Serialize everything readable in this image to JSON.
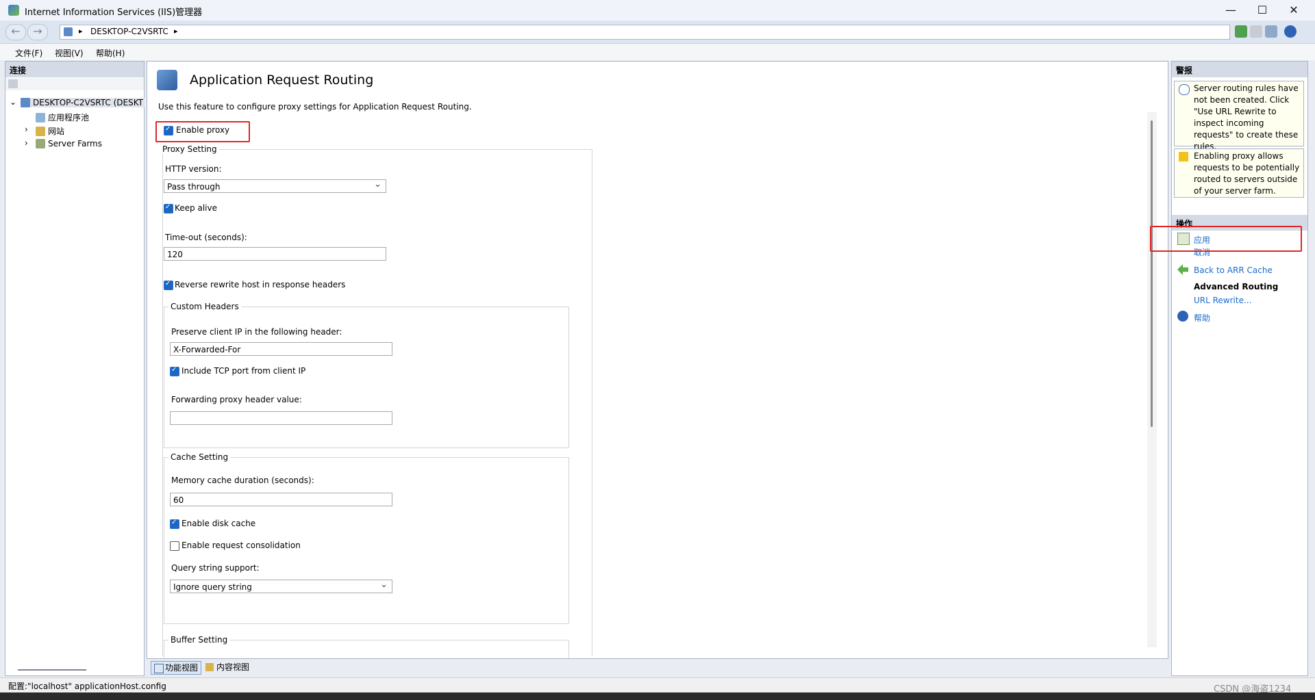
{
  "window": {
    "title": "Internet Information Services (IIS)管理器",
    "min_glyph": "—",
    "max_glyph": "☐",
    "close_glyph": "✕"
  },
  "address": {
    "back_glyph": "←",
    "forward_glyph": "→",
    "crumb": "DESKTOP-C2VSRTC",
    "crumb_arrow": "▸"
  },
  "menu": {
    "file": "文件(F)",
    "view": "视图(V)",
    "help": "帮助(H)"
  },
  "connections": {
    "header": "连接",
    "tree": [
      {
        "label": "DESKTOP-C2VSRTC (DESKT",
        "expander": "⌄"
      },
      {
        "label": "应用程序池",
        "expander": ""
      },
      {
        "label": "网站",
        "expander": "›"
      },
      {
        "label": "Server Farms",
        "expander": "›"
      }
    ]
  },
  "feature": {
    "title": "Application Request Routing",
    "description": "Use this feature to configure proxy settings for Application Request Routing.",
    "enable_proxy": {
      "label": "Enable proxy",
      "checked": true
    },
    "proxy_setting": {
      "title": "Proxy Setting",
      "http_version_label": "HTTP version:",
      "http_version_value": "Pass through",
      "keep_alive": {
        "label": "Keep alive",
        "checked": true
      },
      "timeout_label": "Time-out (seconds):",
      "timeout_value": "120",
      "reverse_rewrite": {
        "label": "Reverse rewrite host in response headers",
        "checked": true
      }
    },
    "custom_headers": {
      "title": "Custom Headers",
      "preserve_ip_label": "Preserve client IP in the following header:",
      "preserve_ip_value": "X-Forwarded-For",
      "include_tcp_port": {
        "label": "Include TCP port from client IP",
        "checked": true
      },
      "forwarding_label": "Forwarding proxy header value:",
      "forwarding_value": ""
    },
    "cache_setting": {
      "title": "Cache Setting",
      "memory_cache_label": "Memory cache duration (seconds):",
      "memory_cache_value": "60",
      "enable_disk_cache": {
        "label": "Enable disk cache",
        "checked": true
      },
      "enable_request_consolidation": {
        "label": "Enable request consolidation",
        "checked": false
      },
      "query_string_label": "Query string support:",
      "query_string_value": "Ignore query string"
    },
    "buffer_setting": {
      "title": "Buffer Setting"
    }
  },
  "view_tabs": {
    "features": "功能视图",
    "content": "内容视图"
  },
  "alerts": {
    "header": "警报",
    "items": [
      {
        "type": "info",
        "text": "Server routing rules have not been created. Click \"Use URL Rewrite to inspect incoming requests\" to create these rules."
      },
      {
        "type": "warning",
        "text": "Enabling proxy allows requests to be potentially routed to servers outside of your server farm."
      }
    ]
  },
  "actions": {
    "header": "操作",
    "apply": "应用",
    "cancel": "取消",
    "back": "Back to ARR Cache",
    "advanced_routing": "Advanced Routing",
    "url_rewrite": "URL Rewrite...",
    "help": "帮助"
  },
  "status": {
    "text": "配置:\"localhost\" applicationHost.config",
    "watermark": "CSDN @海盗1234"
  },
  "colors": {
    "accent": "#1c66c5",
    "highlight_box": "#e02424",
    "link": "#1a6bc9"
  }
}
